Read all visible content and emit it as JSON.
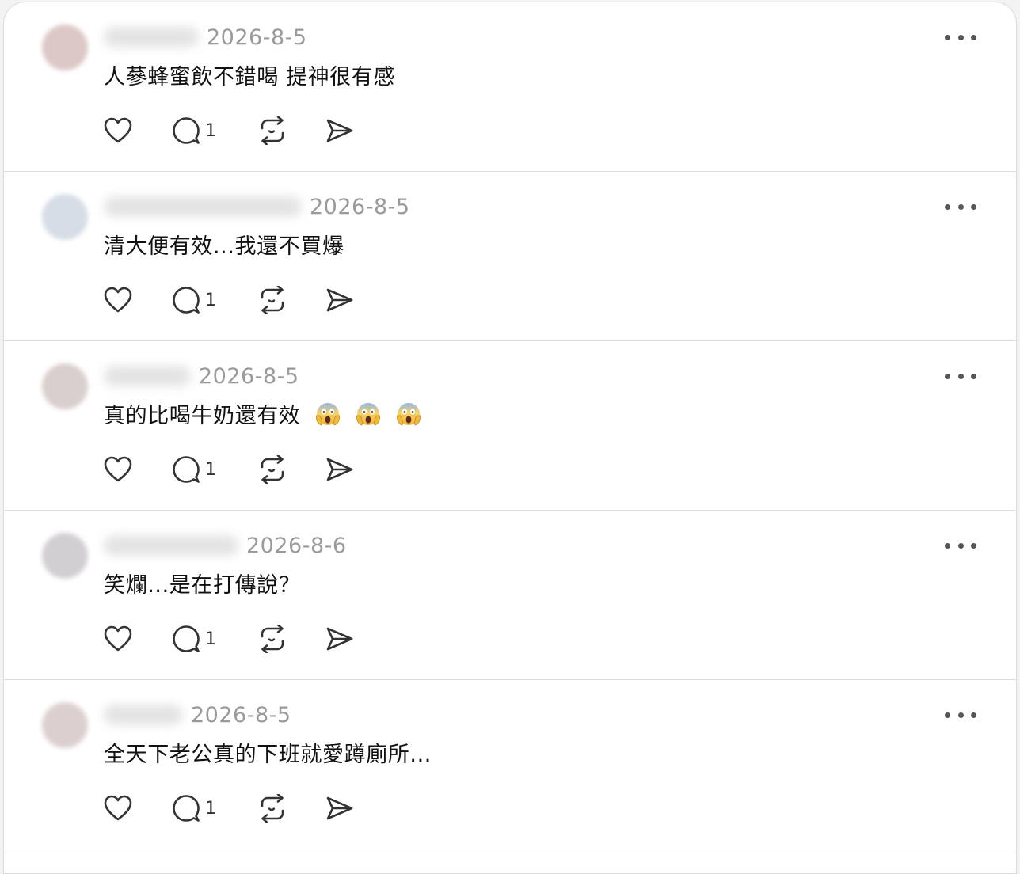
{
  "posts": [
    {
      "avatar_color": "#dcc8c6",
      "date": "2026-8-5",
      "text": "人蔘蜂蜜飲不錯喝 提神很有感",
      "reply_count": "1",
      "emoji_count": 0
    },
    {
      "avatar_color": "#d6dde6",
      "date": "2026-8-5",
      "text": "清大便有效...我還不買爆",
      "reply_count": "1",
      "emoji_count": 0
    },
    {
      "avatar_color": "#d9cfcd",
      "date": "2026-8-5",
      "text": "真的比喝牛奶還有效",
      "reply_count": "1",
      "emoji_count": 3
    },
    {
      "avatar_color": "#d2cfd2",
      "date": "2026-8-6",
      "text": "笑爛...是在打傳說？",
      "reply_count": "1",
      "emoji_count": 0
    },
    {
      "avatar_color": "#dcd0cf",
      "date": "2026-8-5",
      "text": "全天下老公真的下班就愛蹲廁所...",
      "reply_count": "1",
      "emoji_count": 0
    }
  ],
  "icons": {
    "like": "heart-icon",
    "reply": "comment-icon",
    "repost": "repost-icon",
    "share": "send-icon",
    "more": "more-icon",
    "emoji": "face-screaming-in-fear-emoji"
  },
  "colors": {
    "text": "#111111",
    "muted": "#9a9a9a",
    "icon": "#333333",
    "divider": "#dedede"
  }
}
